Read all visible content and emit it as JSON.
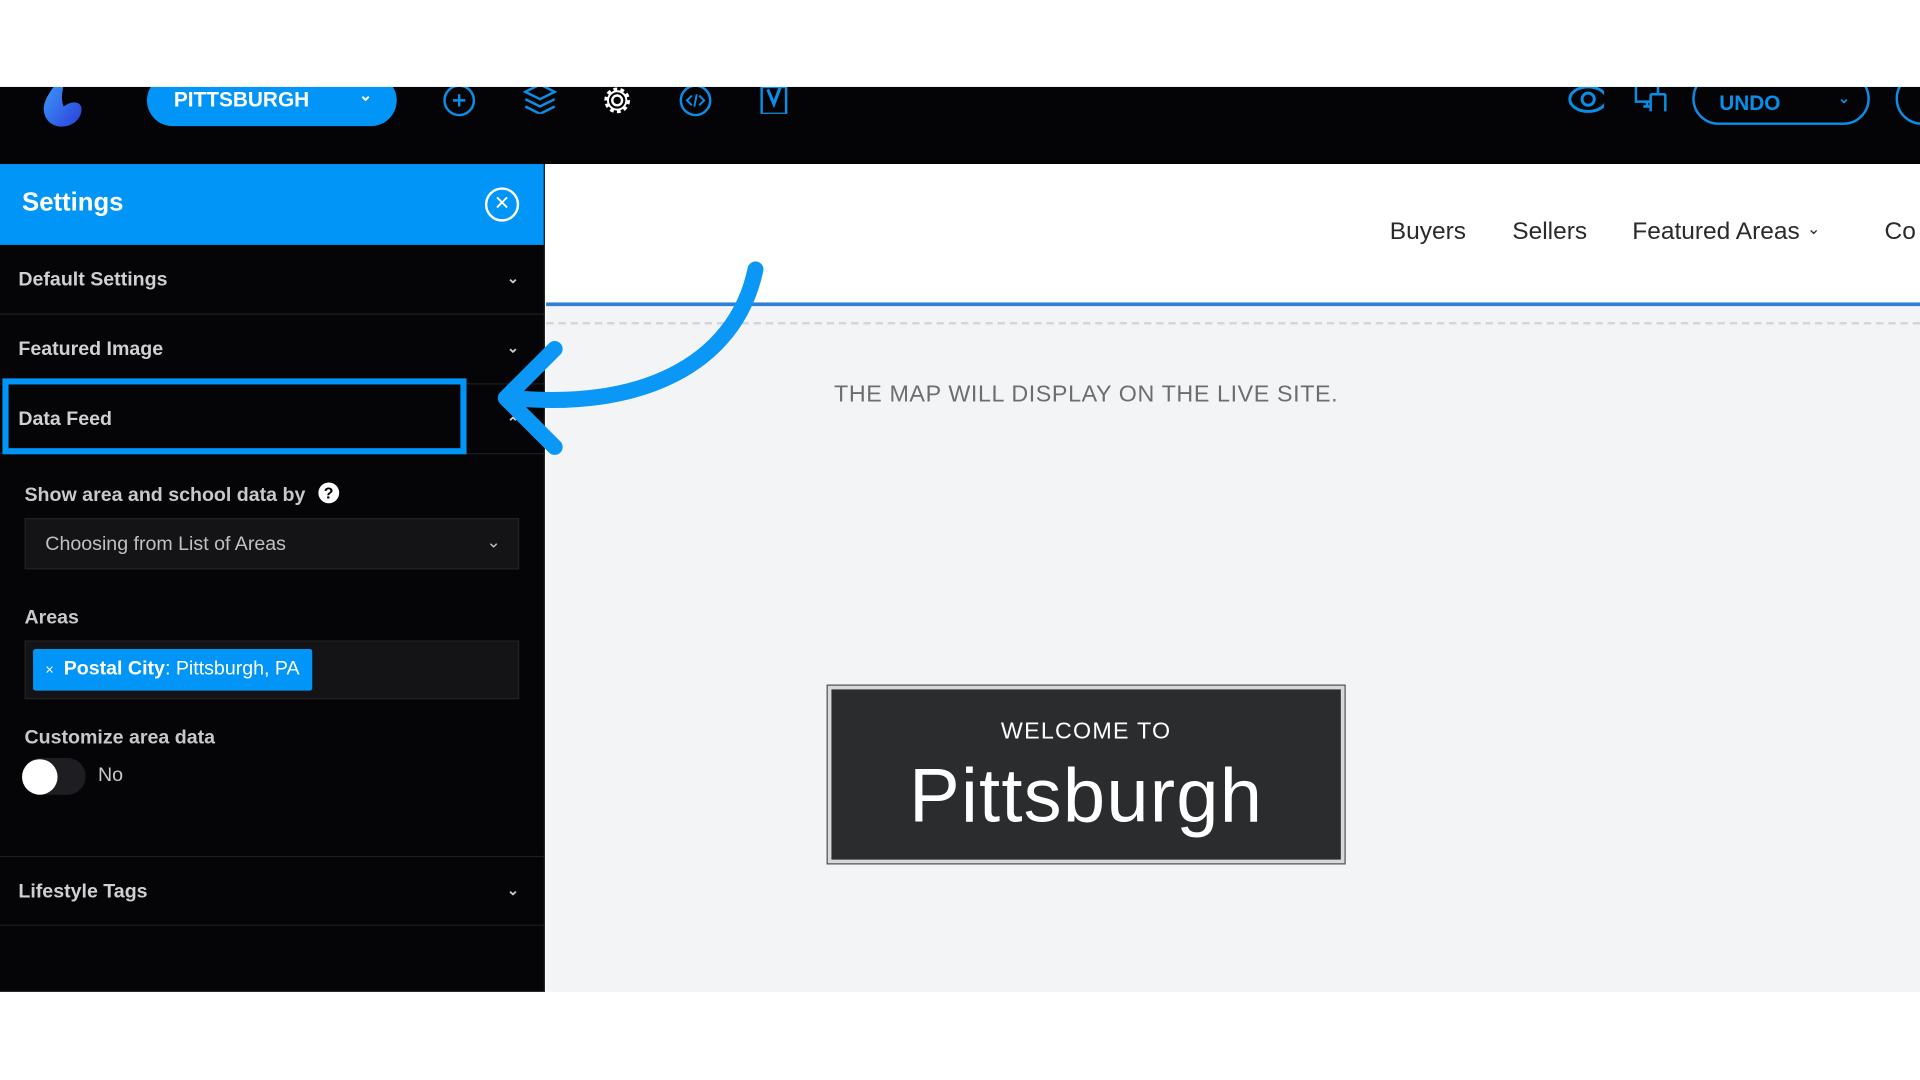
{
  "topbar": {
    "site_selector": "PITTSBURGH",
    "undo_label": "UNDO",
    "icons": [
      "logo",
      "plus-circle-icon",
      "layers-icon",
      "gear-icon",
      "code-icon",
      "yoast-icon",
      "eye-icon",
      "devices-icon"
    ],
    "accent": "#0095f6"
  },
  "sidebar": {
    "title": "Settings",
    "sections": [
      {
        "label": "Default Settings"
      },
      {
        "label": "Featured Image"
      },
      {
        "label": "Data Feed",
        "expanded": true
      },
      {
        "label": "Lifestyle Tags"
      }
    ],
    "data_feed": {
      "show_by_label": "Show area and school data by",
      "show_by_value": "Choosing from List of Areas",
      "areas_label": "Areas",
      "area_tag_key": "Postal City",
      "area_tag_value": ": Pittsburgh, PA",
      "area_tag_remove": "×",
      "customize_label": "Customize area data",
      "customize_value": "No",
      "customize_on": false
    }
  },
  "main": {
    "nav": [
      "Buyers",
      "Sellers",
      "Featured Areas",
      "Co"
    ],
    "map_message": "THE MAP WILL DISPLAY ON THE LIVE SITE.",
    "welcome_small": "WELCOME TO",
    "welcome_big": "Pittsburgh"
  }
}
